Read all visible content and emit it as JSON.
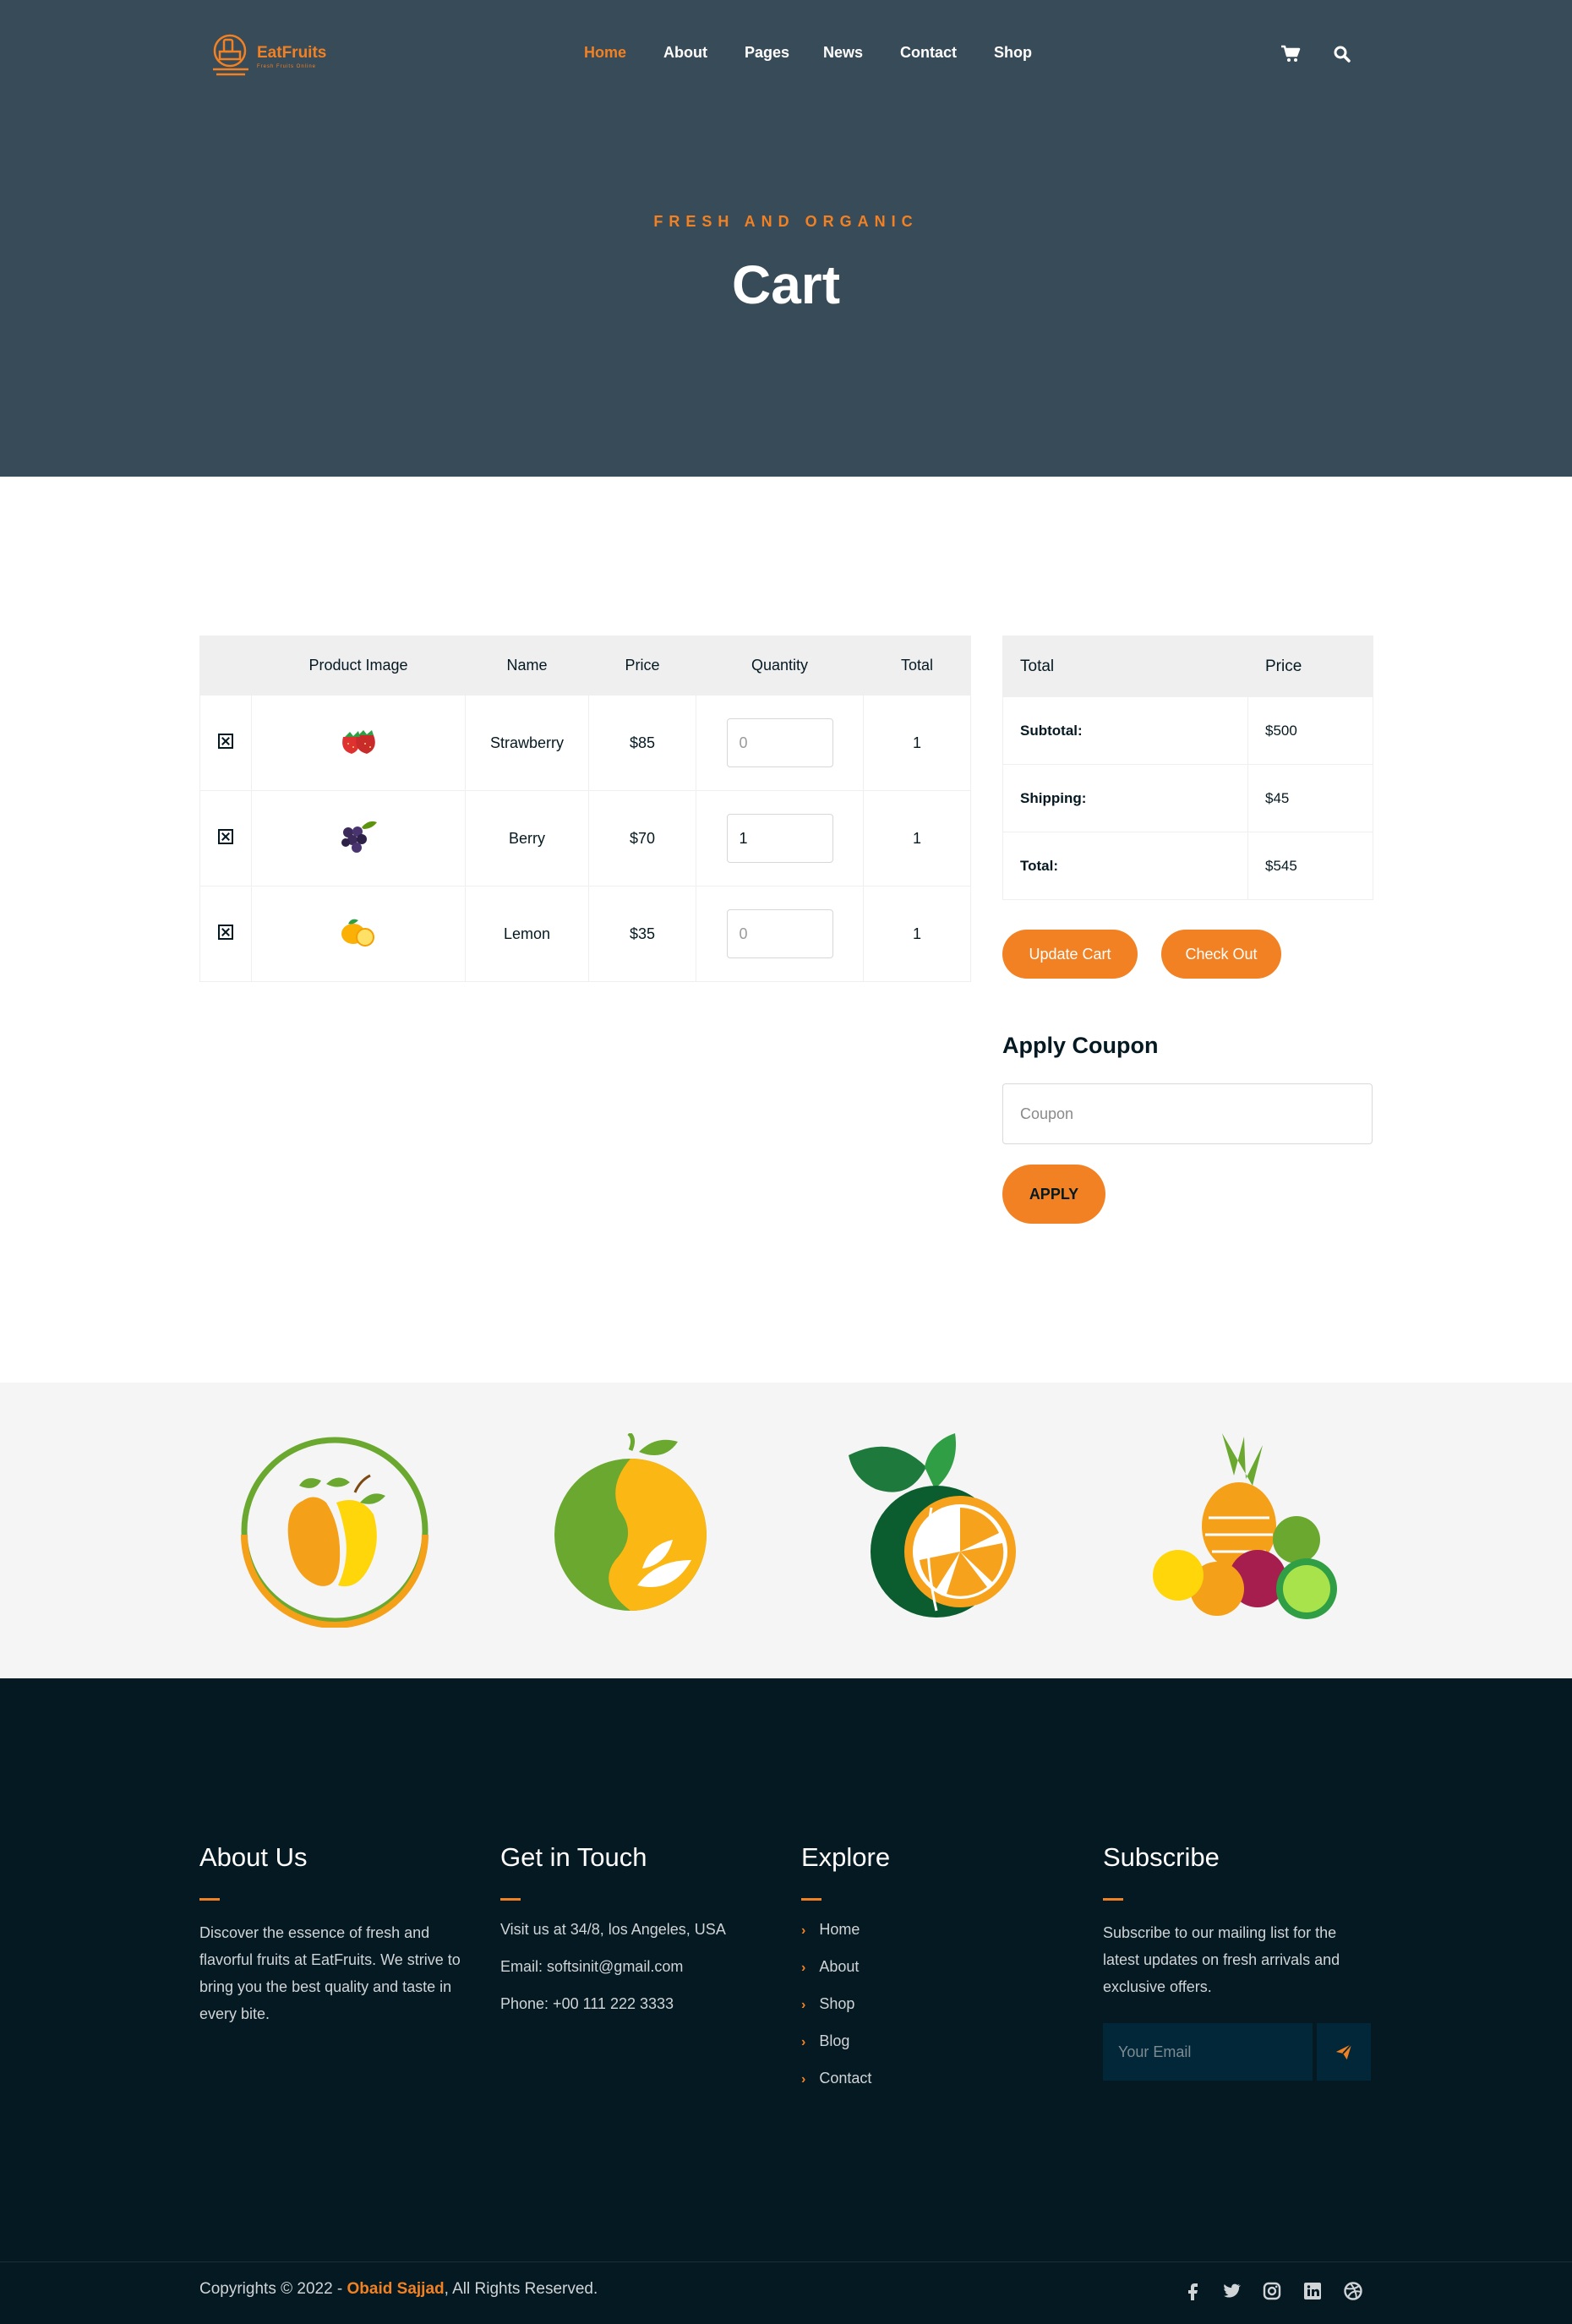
{
  "brand": {
    "name": "EatFruits",
    "tagline": "Fresh Fruits Online",
    "accent": "#f28123"
  },
  "nav": {
    "items": [
      {
        "label": "Home",
        "active": true
      },
      {
        "label": "About"
      },
      {
        "label": "Pages"
      },
      {
        "label": "News"
      },
      {
        "label": "Contact"
      },
      {
        "label": "Shop"
      }
    ],
    "icons": [
      "cart-icon",
      "search-icon"
    ]
  },
  "hero": {
    "eyebrow": "FRESH AND ORGANIC",
    "title": "Cart"
  },
  "cart": {
    "headers": [
      "",
      "Product Image",
      "Name",
      "Price",
      "Quantity",
      "Total"
    ],
    "rows": [
      {
        "image": "strawberry-image",
        "name": "Strawberry",
        "price": "$85",
        "qty_value": "",
        "qty_placeholder": "0",
        "total": "1"
      },
      {
        "image": "grape-image",
        "name": "Berry",
        "price": "$70",
        "qty_value": "1",
        "qty_placeholder": "0",
        "total": "1"
      },
      {
        "image": "lemon-image",
        "name": "Lemon",
        "price": "$35",
        "qty_value": "",
        "qty_placeholder": "0",
        "total": "1"
      }
    ]
  },
  "totals": {
    "headers": [
      "Total",
      "Price"
    ],
    "rows": [
      {
        "label": "Subtotal:",
        "value": "$500"
      },
      {
        "label": "Shipping:",
        "value": "$45"
      },
      {
        "label": "Total:",
        "value": "$545"
      }
    ],
    "update_label": "Update Cart",
    "checkout_label": "Check Out"
  },
  "coupon": {
    "title": "Apply Coupon",
    "placeholder": "Coupon",
    "apply_label": "APPLY"
  },
  "partners": [
    "mango-logo",
    "leaf-fruit-logo",
    "orange-logo",
    "fruit-basket-logo"
  ],
  "footer": {
    "about": {
      "title": "About Us",
      "text": "Discover the essence of fresh and flavorful fruits at EatFruits. We strive to bring you the best quality and taste in every bite."
    },
    "contact": {
      "title": "Get in Touch",
      "lines": [
        "Visit us at 34/8, los Angeles, USA",
        "Email: softsinit@gmail.com",
        "Phone: +00 111 222 3333"
      ]
    },
    "explore": {
      "title": "Explore",
      "links": [
        "Home",
        "About",
        "Shop",
        "Blog",
        "Contact"
      ]
    },
    "subscribe": {
      "title": "Subscribe",
      "text": "Subscribe to our mailing list for the latest updates on fresh arrivals and exclusive offers.",
      "placeholder": "Your Email"
    },
    "copyright": {
      "prefix": "Copyrights © 2022 - ",
      "author": "Obaid Sajjad",
      "suffix": ", All Rights Reserved."
    },
    "social": [
      "facebook-icon",
      "twitter-icon",
      "instagram-icon",
      "linkedin-icon",
      "dribbble-icon"
    ]
  }
}
